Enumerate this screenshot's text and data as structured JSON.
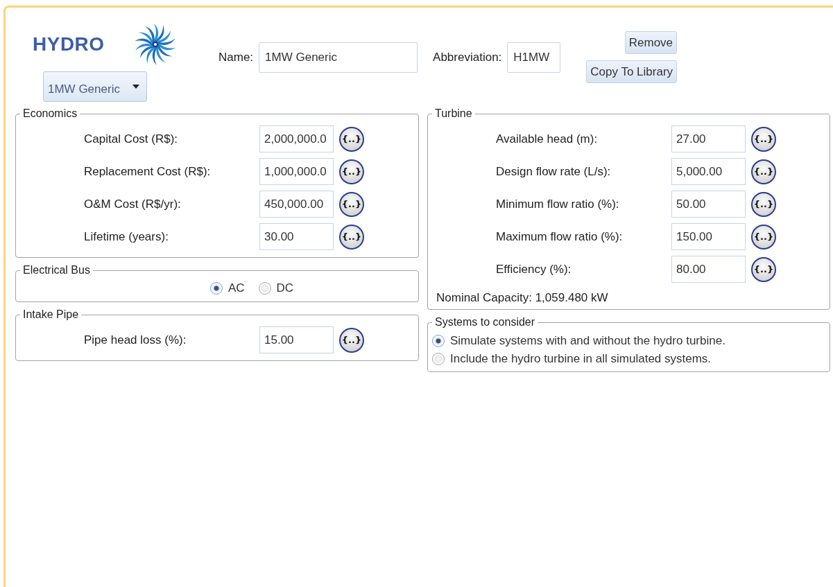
{
  "header": {
    "title": "HYDRO",
    "preset": "1MW Generic",
    "name_label": "Name:",
    "name": "1MW Generic",
    "abbreviation_label": "Abbreviation:",
    "abbreviation": "H1MW",
    "buttons": [
      "Remove",
      "Copy To Library"
    ]
  },
  "economics": {
    "title": "Economics",
    "fields": [
      {
        "label": "Capital Cost (R$):",
        "value": "2,000,000.0",
        "button": "{..}"
      },
      {
        "label": "Replacement Cost (R$):",
        "value": "1,000,000.0",
        "button": "{..}"
      },
      {
        "label": "O&M Cost (R$/yr):",
        "value": "450,000.00",
        "button": "{..}"
      },
      {
        "label": "Lifetime (years):",
        "value": "30.00",
        "button": "{..}"
      }
    ]
  },
  "electrical_bus": {
    "title": "Electrical Bus",
    "options": [
      {
        "label": "AC",
        "selected": true
      },
      {
        "label": "DC",
        "selected": false
      }
    ]
  },
  "intake_pipe": {
    "title": "Intake Pipe",
    "fields": [
      {
        "label": "Pipe head loss (%):",
        "value": "15.00",
        "button": "{..}"
      }
    ]
  },
  "turbine": {
    "title": "Turbine",
    "fields": [
      {
        "label": "Available head (m):",
        "value": "27.00",
        "button": "{..}"
      },
      {
        "label": "Design flow rate (L/s):",
        "value": "5,000.00",
        "button": "{..}"
      },
      {
        "label": "Minimum flow ratio (%):",
        "value": "50.00",
        "button": "{..}"
      },
      {
        "label": "Maximum flow ratio (%):",
        "value": "150.00",
        "button": "{..}"
      },
      {
        "label": "Efficiency (%):",
        "value": "80.00",
        "button": "{..}"
      }
    ],
    "nominal_capacity": "Nominal Capacity: 1,059.480 kW"
  },
  "systems": {
    "title": "Systems to consider",
    "options": [
      {
        "label": "Simulate systems with and without the hydro turbine.",
        "selected": true
      },
      {
        "label": "Include the hydro turbine in all simulated systems.",
        "selected": false
      }
    ]
  }
}
